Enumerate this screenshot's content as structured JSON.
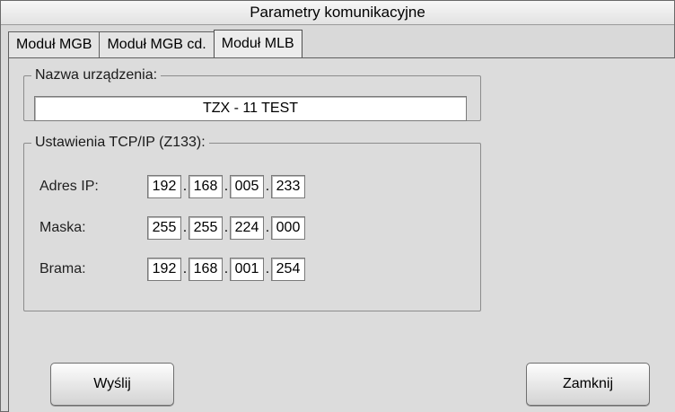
{
  "window": {
    "title": "Parametry komunikacyjne"
  },
  "tabs": [
    {
      "label": "Moduł MGB"
    },
    {
      "label": "Moduł MGB cd."
    },
    {
      "label": "Moduł MLB"
    }
  ],
  "device_name": {
    "legend": "Nazwa urządzenia:",
    "value": "TZX - 11 TEST"
  },
  "tcp": {
    "legend": "Ustawienia TCP/IP (Z133):",
    "separator": ".",
    "ip": {
      "label": "Adres IP:",
      "octets": [
        "192",
        "168",
        "005",
        "233"
      ]
    },
    "mask": {
      "label": "Maska:",
      "octets": [
        "255",
        "255",
        "224",
        "000"
      ]
    },
    "gateway": {
      "label": "Brama:",
      "octets": [
        "192",
        "168",
        "001",
        "254"
      ]
    }
  },
  "buttons": {
    "send": "Wyślij",
    "close": "Zamknij"
  }
}
